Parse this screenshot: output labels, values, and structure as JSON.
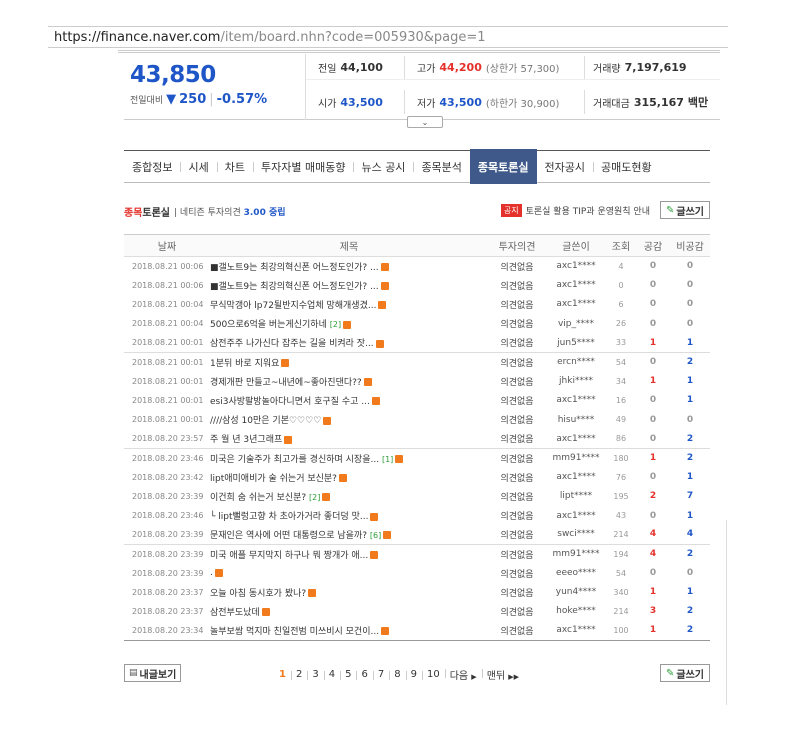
{
  "url": {
    "host": "https://finance.naver.com",
    "path": "/item/board.nhn?code=005930&page=1"
  },
  "quote": {
    "price": "43,850",
    "diff_label": "전일대비",
    "diff_arrow": "▼",
    "diff_value": "250",
    "diff_rate": "-0.57%",
    "cells": {
      "prev_label": "전일",
      "prev_value": "44,100",
      "high_label": "고가",
      "high_value": "44,200",
      "high_sub": "(상한가 57,300)",
      "vol_label": "거래량",
      "vol_value": "7,197,619",
      "open_label": "시가",
      "open_value": "43,500",
      "low_label": "저가",
      "low_value": "43,500",
      "low_sub": "(하한가 30,900)",
      "amt_label": "거래대금",
      "amt_value": "315,167",
      "amt_unit": "백만"
    }
  },
  "tabs": [
    "종합정보",
    "시세",
    "차트",
    "투자자별 매매동향",
    "뉴스 공시",
    "종목분석",
    "종목토론실",
    "전자공시",
    "공매도현황"
  ],
  "active_tab": "종목토론실",
  "board": {
    "title_accent": "종목",
    "title_rest": "토론실",
    "opinion_prefix": "네티즌 투자의견",
    "opinion_value": "3.00 중립",
    "notice_badge": "공지",
    "notice_text": "토론실 활용 TIP과 운영원칙 안내",
    "write_label": "글쓰기",
    "mine_label": "내글보기",
    "columns": [
      "날짜",
      "제목",
      "투자의견",
      "글쓴이",
      "조회",
      "공감",
      "비공감"
    ],
    "rows": [
      {
        "date": "2018.08.21 00:06",
        "title": "■갤노트9는 최강의혁신폰 어느정도인가? ...",
        "count": "",
        "opinion": "의견없음",
        "writer": "axc1****",
        "views": "4",
        "good": "0",
        "bad": "0"
      },
      {
        "date": "2018.08.21 00:06",
        "title": "■갤노트9는 최강의혁신폰 어느정도인가? ...",
        "count": "",
        "opinion": "의견없음",
        "writer": "axc1****",
        "views": "0",
        "good": "0",
        "bad": "0"
      },
      {
        "date": "2018.08.21 00:04",
        "title": "무식막갱아 lp72될반지수업체 망해개생겼...",
        "count": "",
        "opinion": "의견없음",
        "writer": "axc1****",
        "views": "6",
        "good": "0",
        "bad": "0"
      },
      {
        "date": "2018.08.21 00:04",
        "title": "500으로6억을 버는게신기하네",
        "count": "[2]",
        "opinion": "의견없음",
        "writer": "vip_****",
        "views": "26",
        "good": "0",
        "bad": "0"
      },
      {
        "date": "2018.08.21 00:01",
        "title": "삼전주주 나가신다 잡주는 길을 비켜라 잣...",
        "count": "",
        "opinion": "의견없음",
        "writer": "jun5****",
        "views": "33",
        "good": "1",
        "bad": "1"
      },
      {
        "date": "2018.08.21 00:01",
        "title": "1분뒤 바로 지워요",
        "count": "",
        "opinion": "의견없음",
        "writer": "ercn****",
        "views": "54",
        "good": "0",
        "bad": "2"
      },
      {
        "date": "2018.08.21 00:01",
        "title": "경제개판 만들고~내년에~좋아진댄다??",
        "count": "",
        "opinion": "의견없음",
        "writer": "jhki****",
        "views": "34",
        "good": "1",
        "bad": "1"
      },
      {
        "date": "2018.08.21 00:01",
        "title": "esi3사방팔방놀아다니면서 호구질 수고 ...",
        "count": "",
        "opinion": "의견없음",
        "writer": "axc1****",
        "views": "16",
        "good": "0",
        "bad": "1"
      },
      {
        "date": "2018.08.21 00:01",
        "title": "////삼성 10만은 기본♡♡♡♡",
        "count": "",
        "opinion": "의견없음",
        "writer": "hisu****",
        "views": "49",
        "good": "0",
        "bad": "0"
      },
      {
        "date": "2018.08.20 23:57",
        "title": "주 월 년 3년그래프",
        "count": "",
        "opinion": "의견없음",
        "writer": "axc1****",
        "views": "86",
        "good": "0",
        "bad": "2"
      },
      {
        "date": "2018.08.20 23:46",
        "title": "미국은 기술주가 최고가를 경신하며 시장을...",
        "count": "[1]",
        "opinion": "의견없음",
        "writer": "mm91****",
        "views": "180",
        "good": "1",
        "bad": "2"
      },
      {
        "date": "2018.08.20 23:42",
        "title": "lipt애미애비가 술 쉬는거 보신분?",
        "count": "",
        "opinion": "의견없음",
        "writer": "axc1****",
        "views": "76",
        "good": "0",
        "bad": "1"
      },
      {
        "date": "2018.08.20 23:39",
        "title": "이건희 숨 쉬는거 보신분?",
        "count": "[2]",
        "opinion": "의견없음",
        "writer": "lipt****",
        "views": "195",
        "good": "2",
        "bad": "7"
      },
      {
        "date": "2018.08.20 23:46",
        "title": "└ lipt뻘렁고향 차 초아가거라 좋더덩 맛...",
        "count": "",
        "opinion": "의견없음",
        "writer": "axc1****",
        "views": "43",
        "good": "0",
        "bad": "1"
      },
      {
        "date": "2018.08.20 23:39",
        "title": "문재인은 역사에 어떤 대통령으로 남을까?",
        "count": "[6]",
        "opinion": "의견없음",
        "writer": "swci****",
        "views": "214",
        "good": "4",
        "bad": "4"
      },
      {
        "date": "2018.08.20 23:39",
        "title": "미국 애플 무지막지 하구나 뭐 짱개가 애...",
        "count": "",
        "opinion": "의견없음",
        "writer": "mm91****",
        "views": "194",
        "good": "4",
        "bad": "2"
      },
      {
        "date": "2018.08.20 23:39",
        "title": ".",
        "count": "",
        "opinion": "의견없음",
        "writer": "eeeo****",
        "views": "54",
        "good": "0",
        "bad": "0"
      },
      {
        "date": "2018.08.20 23:37",
        "title": "오늘 아침 동시호가 봤나?",
        "count": "",
        "opinion": "의견없음",
        "writer": "yun4****",
        "views": "340",
        "good": "1",
        "bad": "1"
      },
      {
        "date": "2018.08.20 23:37",
        "title": "삼전부도났데",
        "count": "",
        "opinion": "의견없음",
        "writer": "hoke****",
        "views": "214",
        "good": "3",
        "bad": "2"
      },
      {
        "date": "2018.08.20 23:34",
        "title": "놀부보쌈 먹지마 친일전범 미쓰비시 모건이...",
        "count": "",
        "opinion": "의견없음",
        "writer": "axc1****",
        "views": "100",
        "good": "1",
        "bad": "2"
      }
    ]
  },
  "pager": {
    "pages": [
      "1",
      "2",
      "3",
      "4",
      "5",
      "6",
      "7",
      "8",
      "9",
      "10"
    ],
    "current": "1",
    "next_label": "다음",
    "last_label": "맨뒤"
  },
  "colors": {
    "up": "#e4312b",
    "down": "#1f56c7",
    "tab_active": "#3f5a8a",
    "new_badge": "#f07a1c"
  }
}
